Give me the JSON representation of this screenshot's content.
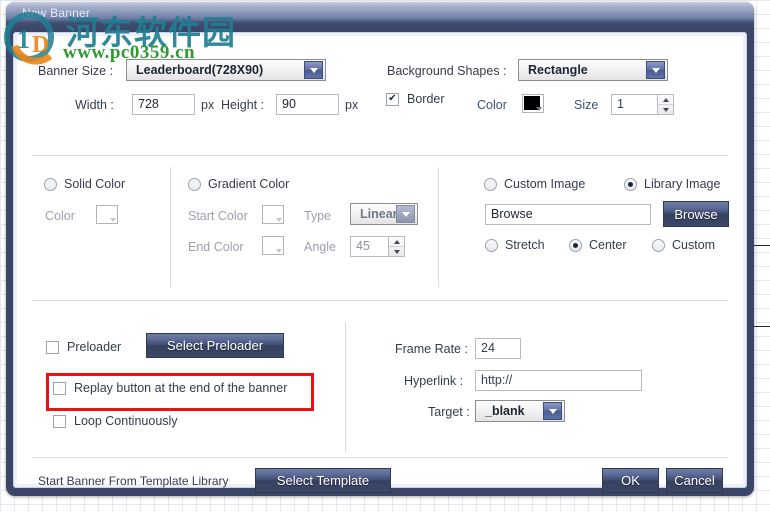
{
  "window": {
    "title": "New Banner"
  },
  "watermark": {
    "site_name_cn": "河东软件园",
    "site_url": "www.pc0359.cn"
  },
  "size_section": {
    "banner_size_label": "Banner Size :",
    "banner_size_value": "Leaderboard(728X90)",
    "width_label": "Width :",
    "width_value": "728",
    "width_unit": "px",
    "height_label": "Height :",
    "height_value": "90",
    "height_unit": "px",
    "background_shapes_label": "Background Shapes :",
    "background_shapes_value": "Rectangle",
    "border_label": "Border",
    "border_checked": true,
    "color_label": "Color",
    "color_value": "#000000",
    "size_label": "Size",
    "size_value": "1"
  },
  "fill_section": {
    "solid_color_label": "Solid Color",
    "solid_color_selected": false,
    "color_label": "Color",
    "gradient_color_label": "Gradient Color",
    "gradient_color_selected": false,
    "start_color_label": "Start Color",
    "end_color_label": "End Color",
    "type_label": "Type",
    "type_value": "Linear",
    "angle_label": "Angle",
    "angle_value": "45",
    "custom_image_label": "Custom Image",
    "custom_image_selected": false,
    "library_image_label": "Library Image",
    "library_image_selected": true,
    "browse_field_value": "Browse",
    "browse_button_label": "Browse",
    "stretch_label": "Stretch",
    "stretch_selected": false,
    "center_label": "Center",
    "center_selected": true,
    "custom_label": "Custom",
    "custom_selected": false
  },
  "playback_section": {
    "preloader_label": "Preloader",
    "preloader_checked": false,
    "select_preloader_button": "Select Preloader",
    "replay_label": "Replay button at the end of the banner",
    "replay_checked": false,
    "replay_highlighted": true,
    "loop_label": "Loop Continuously",
    "loop_checked": false,
    "frame_rate_label": "Frame Rate :",
    "frame_rate_value": "24",
    "hyperlink_label": "Hyperlink :",
    "hyperlink_value": "http://",
    "target_label": "Target :",
    "target_value": "_blank"
  },
  "footer": {
    "template_library_label": "Start Banner From Template Library",
    "select_template_button": "Select Template",
    "ok_button": "OK",
    "cancel_button": "Cancel"
  },
  "colors": {
    "title_bar_dark": "#3a4567",
    "button_blue": "#3e4c72",
    "highlight_red": "#ee1111",
    "label_text": "#333c4f"
  }
}
